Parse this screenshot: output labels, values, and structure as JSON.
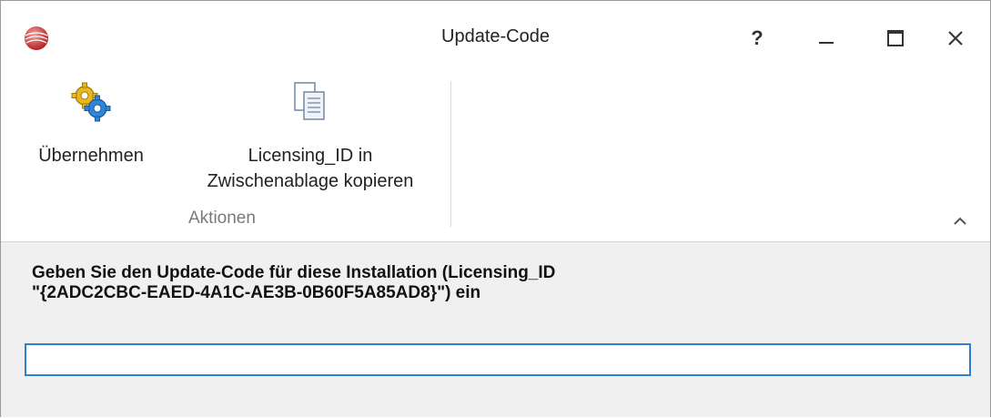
{
  "window": {
    "title": "Update-Code",
    "help_label": "?",
    "icons": {
      "app": "app-logo-icon",
      "help": "help-icon",
      "minimize": "minimize-icon",
      "maximize": "maximize-icon",
      "close": "close-icon"
    }
  },
  "ribbon": {
    "apply_label": "Übernehmen",
    "apply_icon": "gears-icon",
    "copy_label_line1": "Licensing_ID in",
    "copy_label_line2": "Zwischenablage kopieren",
    "copy_icon": "copy-documents-icon",
    "group_label": "Aktionen",
    "collapse_icon": "chevron-up-icon"
  },
  "content": {
    "prompt_line1": "Geben Sie den Update-Code für diese Installation (Licensing_ID",
    "prompt_line2": "\"{2ADC2CBC-EAED-4A1C-AE3B-0B60F5A85AD8}\") ein",
    "code_value": "",
    "code_placeholder": ""
  },
  "colors": {
    "input_border": "#2f7fd0",
    "content_bg": "#f0f0f0",
    "gear_gold": "#e8b81c",
    "gear_blue": "#2f86d6"
  }
}
